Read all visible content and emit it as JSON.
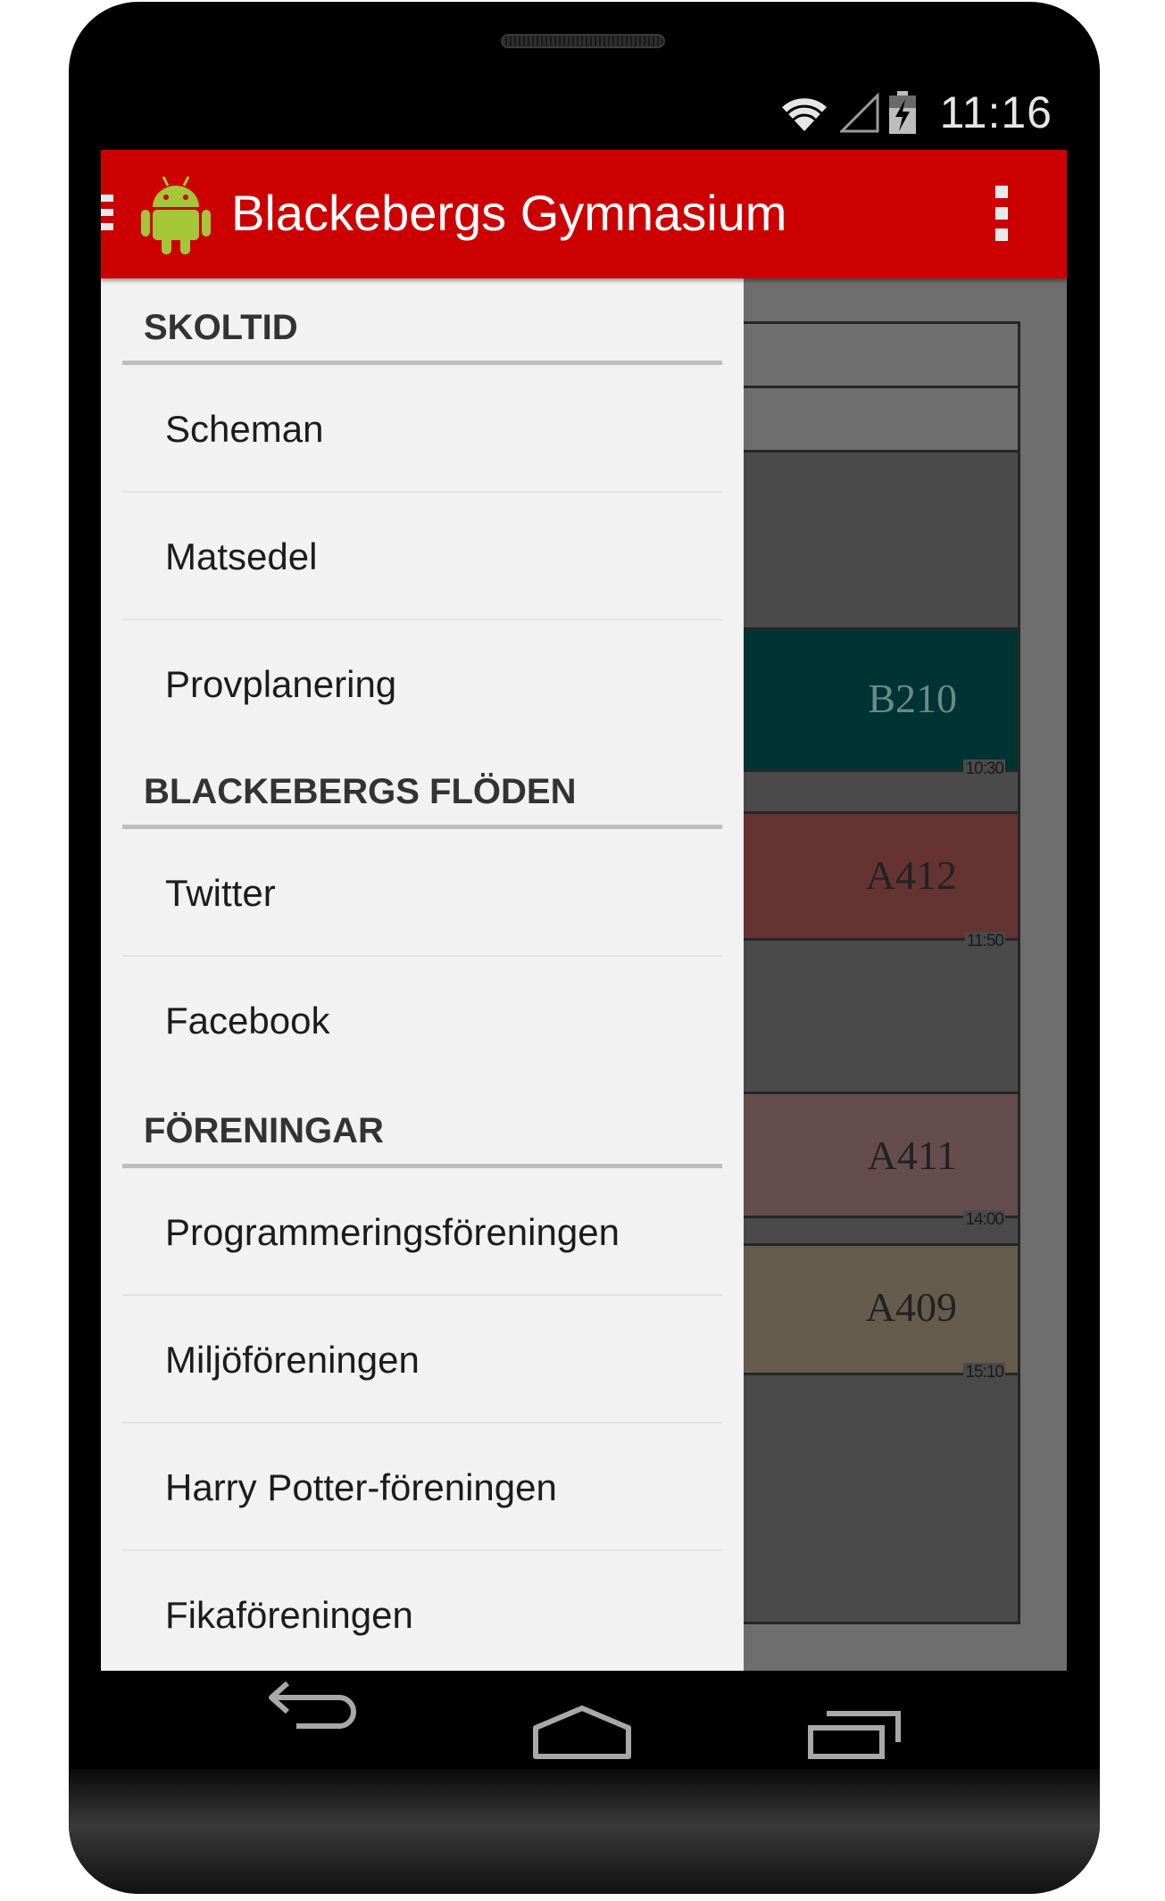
{
  "status_bar": {
    "time": "11:16",
    "icons": [
      "wifi-icon",
      "signal-icon",
      "battery-charging-icon"
    ]
  },
  "action_bar": {
    "title": "Blackebergs Gymnasium",
    "logo_icon": "android-logo-icon",
    "menu_icon": "overflow-menu-icon",
    "background_color": "#cc0000"
  },
  "drawer": {
    "sections": [
      {
        "label": "SKOLTID",
        "items": [
          {
            "label": "Scheman"
          },
          {
            "label": "Matsedel"
          },
          {
            "label": "Provplanering"
          }
        ]
      },
      {
        "label": "BLACKEBERGS FLÖDEN",
        "items": [
          {
            "label": "Twitter"
          },
          {
            "label": "Facebook"
          }
        ]
      },
      {
        "label": "FÖRENINGAR",
        "items": [
          {
            "label": "Programmeringsföreningen"
          },
          {
            "label": "Miljöföreningen"
          },
          {
            "label": "Harry Potter-föreningen"
          },
          {
            "label": "Fikaföreningen"
          }
        ]
      }
    ]
  },
  "schedule": {
    "blocks": [
      {
        "room": "B210",
        "end_time": "10:30",
        "color": "#003333"
      },
      {
        "room": "A412",
        "end_time": "11:50",
        "color": "#663333"
      },
      {
        "room": "A411",
        "end_time": "14:00",
        "color": "#664d4d"
      },
      {
        "room": "A409",
        "end_time": "15:10",
        "color": "#665c4d"
      }
    ]
  },
  "nav_bar": {
    "icons": [
      "back-icon",
      "home-icon",
      "recent-apps-icon"
    ]
  }
}
